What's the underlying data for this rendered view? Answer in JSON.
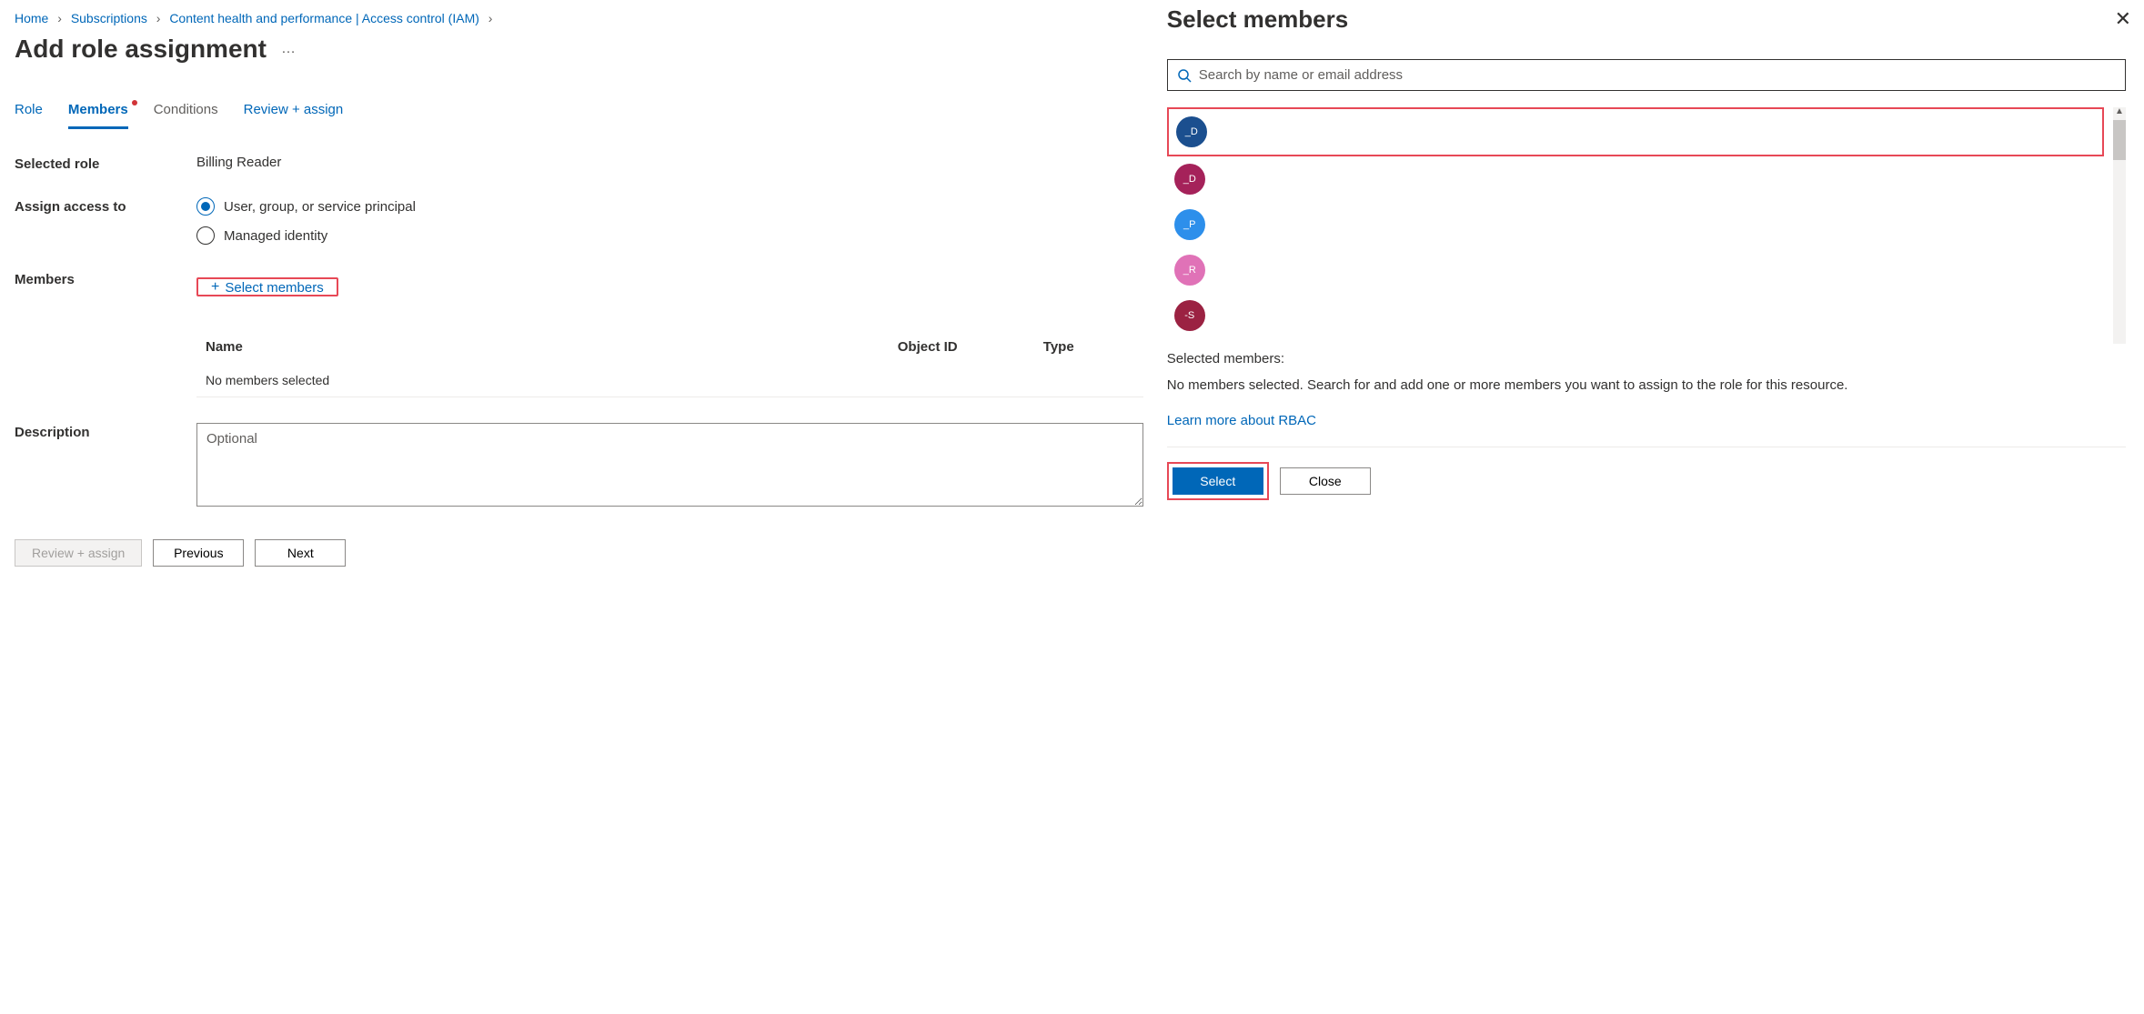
{
  "breadcrumb": {
    "items": [
      "Home",
      "Subscriptions",
      "Content health and performance | Access control (IAM)"
    ]
  },
  "page": {
    "title": "Add role assignment"
  },
  "tabs": {
    "role": "Role",
    "members": "Members",
    "conditions": "Conditions",
    "review": "Review + assign"
  },
  "form": {
    "selected_role_label": "Selected role",
    "selected_role_value": "Billing Reader",
    "assign_access_label": "Assign access to",
    "assign_option_user": "User, group, or service principal",
    "assign_option_managed": "Managed identity",
    "members_label": "Members",
    "select_members_link": "Select members",
    "table": {
      "col_name": "Name",
      "col_oid": "Object ID",
      "col_type": "Type",
      "empty_msg": "No members selected"
    },
    "description_label": "Description",
    "description_placeholder": "Optional"
  },
  "footer": {
    "review": "Review + assign",
    "previous": "Previous",
    "next": "Next"
  },
  "panel": {
    "title": "Select members",
    "search_placeholder": "Search by name or email address",
    "members": [
      {
        "initials": "_D",
        "color": "av-navy"
      },
      {
        "initials": "_D",
        "color": "av-maroon"
      },
      {
        "initials": "_P",
        "color": "av-blue"
      },
      {
        "initials": "_R",
        "color": "av-pink"
      },
      {
        "initials": "-S",
        "color": "av-darkred"
      }
    ],
    "selected_label": "Selected members:",
    "no_members_msg": "No members selected. Search for and add one or more members you want to assign to the role for this resource.",
    "rbac_link": "Learn more about RBAC",
    "select_btn": "Select",
    "close_btn": "Close"
  }
}
